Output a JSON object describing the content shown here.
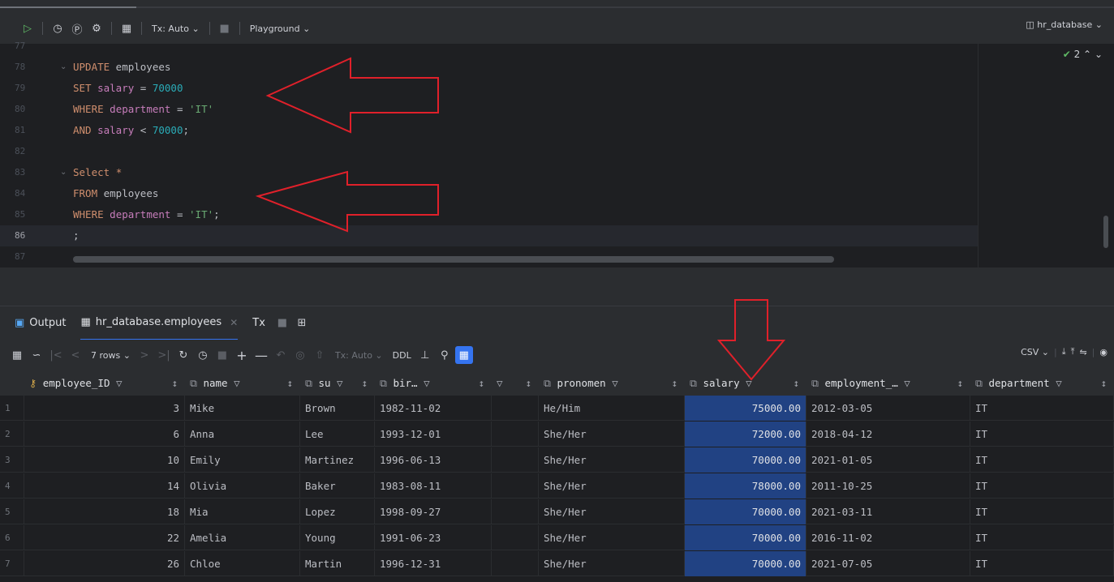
{
  "toolbar": {
    "tx_mode": "Tx: Auto",
    "playground": "Playground",
    "database": "hr_database"
  },
  "editor": {
    "lines": [
      {
        "n": "77",
        "tokens": []
      },
      {
        "n": "78",
        "tokens": [
          {
            "c": "kw",
            "t": "UPDATE"
          },
          {
            "c": "pl",
            "t": " employees"
          }
        ]
      },
      {
        "n": "79",
        "tokens": [
          {
            "c": "kw",
            "t": "SET"
          },
          {
            "c": "pl",
            "t": " "
          },
          {
            "c": "id",
            "t": "salary"
          },
          {
            "c": "pl",
            "t": " = "
          },
          {
            "c": "num",
            "t": "70000"
          }
        ]
      },
      {
        "n": "80",
        "tokens": [
          {
            "c": "kw",
            "t": "WHERE"
          },
          {
            "c": "pl",
            "t": " "
          },
          {
            "c": "id",
            "t": "department"
          },
          {
            "c": "pl",
            "t": " = "
          },
          {
            "c": "str",
            "t": "'IT'"
          }
        ]
      },
      {
        "n": "81",
        "tokens": [
          {
            "c": "kw",
            "t": "AND"
          },
          {
            "c": "pl",
            "t": " "
          },
          {
            "c": "id",
            "t": "salary"
          },
          {
            "c": "pl",
            "t": " < "
          },
          {
            "c": "num",
            "t": "70000"
          },
          {
            "c": "pl",
            "t": ";"
          }
        ]
      },
      {
        "n": "82",
        "tokens": []
      },
      {
        "n": "83",
        "tokens": [
          {
            "c": "kw",
            "t": "Select"
          },
          {
            "c": "pl",
            "t": " "
          },
          {
            "c": "kw",
            "t": "*"
          }
        ]
      },
      {
        "n": "84",
        "tokens": [
          {
            "c": "kw",
            "t": "FROM"
          },
          {
            "c": "pl",
            "t": " employees"
          }
        ]
      },
      {
        "n": "85",
        "tokens": [
          {
            "c": "kw",
            "t": "WHERE"
          },
          {
            "c": "pl",
            "t": " "
          },
          {
            "c": "id",
            "t": "department"
          },
          {
            "c": "pl",
            "t": " = "
          },
          {
            "c": "str",
            "t": "'IT'"
          },
          {
            "c": "pl",
            "t": ";"
          }
        ]
      },
      {
        "n": "86",
        "tokens": [
          {
            "c": "pl",
            "t": ";"
          }
        ]
      },
      {
        "n": "87",
        "tokens": []
      }
    ],
    "inspection_count": "2"
  },
  "results": {
    "tabs": {
      "output": "Output",
      "table": "hr_database.employees",
      "tx": "Tx"
    },
    "toolbar": {
      "rows": "7 rows",
      "tx_mode": "Tx: Auto",
      "ddl": "DDL",
      "export_format": "CSV"
    },
    "columns": [
      "employee_ID",
      "name",
      "su",
      "bir…",
      "",
      "pronomen",
      "salary",
      "employment_…",
      "department"
    ],
    "rows": [
      [
        "1",
        "3",
        "Mike",
        "Brown",
        "1982-11-02",
        "",
        "He/Him",
        "75000.00",
        "2012-03-05",
        "IT"
      ],
      [
        "2",
        "6",
        "Anna",
        "Lee",
        "1993-12-01",
        "",
        "She/Her",
        "72000.00",
        "2018-04-12",
        "IT"
      ],
      [
        "3",
        "10",
        "Emily",
        "Martinez",
        "1996-06-13",
        "",
        "She/Her",
        "70000.00",
        "2021-01-05",
        "IT"
      ],
      [
        "4",
        "14",
        "Olivia",
        "Baker",
        "1983-08-11",
        "",
        "She/Her",
        "78000.00",
        "2011-10-25",
        "IT"
      ],
      [
        "5",
        "18",
        "Mia",
        "Lopez",
        "1998-09-27",
        "",
        "She/Her",
        "70000.00",
        "2021-03-11",
        "IT"
      ],
      [
        "6",
        "22",
        "Amelia",
        "Young",
        "1991-06-23",
        "",
        "She/Her",
        "70000.00",
        "2016-11-02",
        "IT"
      ],
      [
        "7",
        "26",
        "Chloe",
        "Martin",
        "1996-12-31",
        "",
        "She/Her",
        "70000.00",
        "2021-07-05",
        "IT"
      ]
    ]
  },
  "colors": {
    "background": "#1e1f22",
    "panel": "#2b2d30",
    "keyword": "#cf8e6d",
    "identifier": "#c77dbb",
    "number": "#2aacb8",
    "string": "#6aab73",
    "selection": "#214283",
    "annotation_arrow": "#e0202a"
  },
  "icons": [
    "run-icon",
    "history-icon",
    "pin-icon",
    "settings-icon",
    "table-icon",
    "stop-icon",
    "database-icon",
    "filter-icon",
    "sort-icon",
    "refresh-icon",
    "add-row-icon",
    "delete-row-icon",
    "search-icon",
    "export-icon",
    "upload-icon",
    "compare-icon",
    "view-icon"
  ]
}
